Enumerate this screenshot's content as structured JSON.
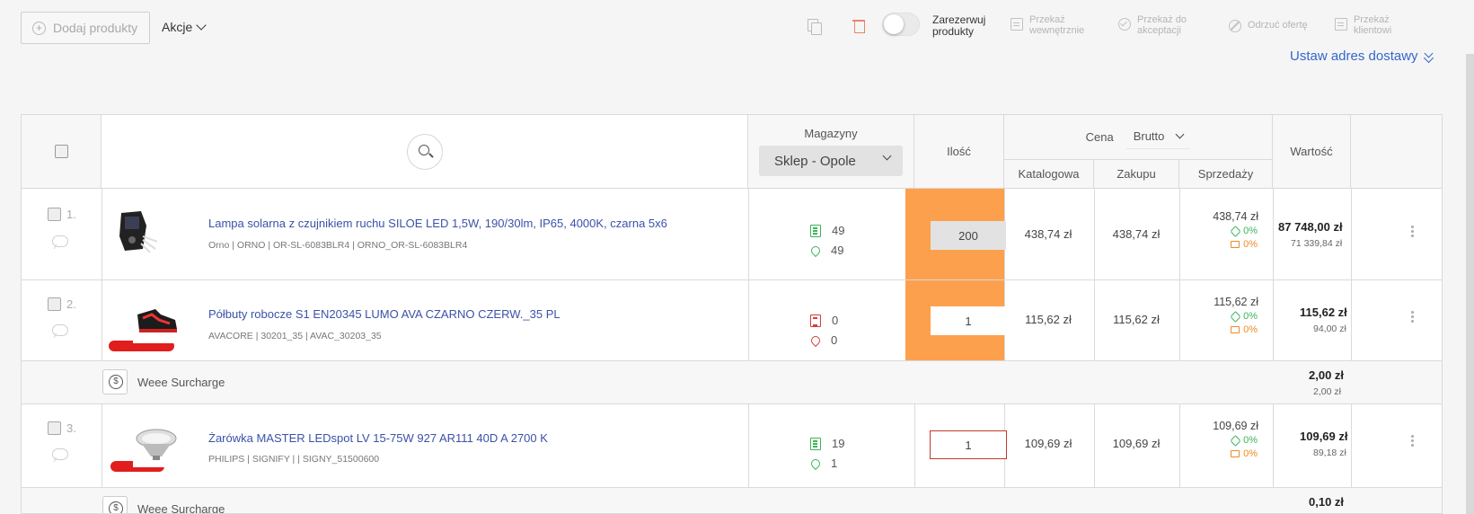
{
  "toolbar": {
    "add_label": "Dodaj produkty",
    "actions_label": "Akcje",
    "reserve_label": "Zarezerwuj produkty",
    "transfer_internal": "Przekaż wewnętrznie",
    "transfer_accept": "Przekaż do akceptacji",
    "reject_offer": "Odrzuć ofertę",
    "transfer_client": "Przekaż klientowi",
    "delivery_label": "Ustaw adres dostawy"
  },
  "header": {
    "warehouses": "Magazyny",
    "warehouse_selected": "Sklep - Opole",
    "quantity": "Ilość",
    "price": "Cena",
    "price_mode": "Brutto",
    "catalog": "Katalogowa",
    "purchase": "Zakupu",
    "sale": "Sprzedaży",
    "value": "Wartość"
  },
  "rows": [
    {
      "num": "1.",
      "name": "Lampa solarna z czujnikiem ruchu SILOE LED 1,5W, 190/30lm, IP65, 4000K, czarna 5x6",
      "meta": "Orno | ORNO | OR-SL-6083BLR4 | ORNO_OR-SL-6083BLR4",
      "stock_count": "49",
      "location_count": "49",
      "qty": "200",
      "catalog_price": "438,74 zł",
      "purchase_price": "438,74 zł",
      "sale_price": "438,74 zł",
      "discount": "0%",
      "margin": "0%",
      "value_gross": "87 748,00 zł",
      "value_net": "71 339,84 zł"
    },
    {
      "num": "2.",
      "name": "Półbuty robocze S1 EN20345 LUMO AVA CZARNO CZERW._35 PL",
      "meta": "AVACORE | 30201_35 | AVAC_30203_35",
      "stock_count": "0",
      "location_count": "0",
      "qty": "1",
      "catalog_price": "115,62 zł",
      "purchase_price": "115,62 zł",
      "sale_price": "115,62 zł",
      "discount": "0%",
      "margin": "0%",
      "value_gross": "115,62 zł",
      "value_net": "94,00 zł"
    },
    {
      "num": "3.",
      "name": "Żarówka MASTER LEDspot LV 15-75W 927 AR111 40D A 2700 K",
      "meta": "PHILIPS | SIGNIFY | | SIGNY_51500600",
      "stock_count": "19",
      "location_count": "1",
      "qty": "1",
      "catalog_price": "109,69 zł",
      "purchase_price": "109,69 zł",
      "sale_price": "109,69 zł",
      "discount": "0%",
      "margin": "0%",
      "value_gross": "109,69 zł",
      "value_net": "89,18 zł"
    }
  ],
  "surcharges": [
    {
      "label": "Weee Surcharge",
      "value_gross": "2,00 zł",
      "value_net": "2,00 zł"
    },
    {
      "label": "Weee Surcharge",
      "value_gross": "0,10 zł"
    }
  ],
  "colors": {
    "accent_orange": "#fda04e",
    "link_blue": "#3b52a8",
    "stock_green": "#3db357",
    "stock_red": "#d63b3b"
  }
}
